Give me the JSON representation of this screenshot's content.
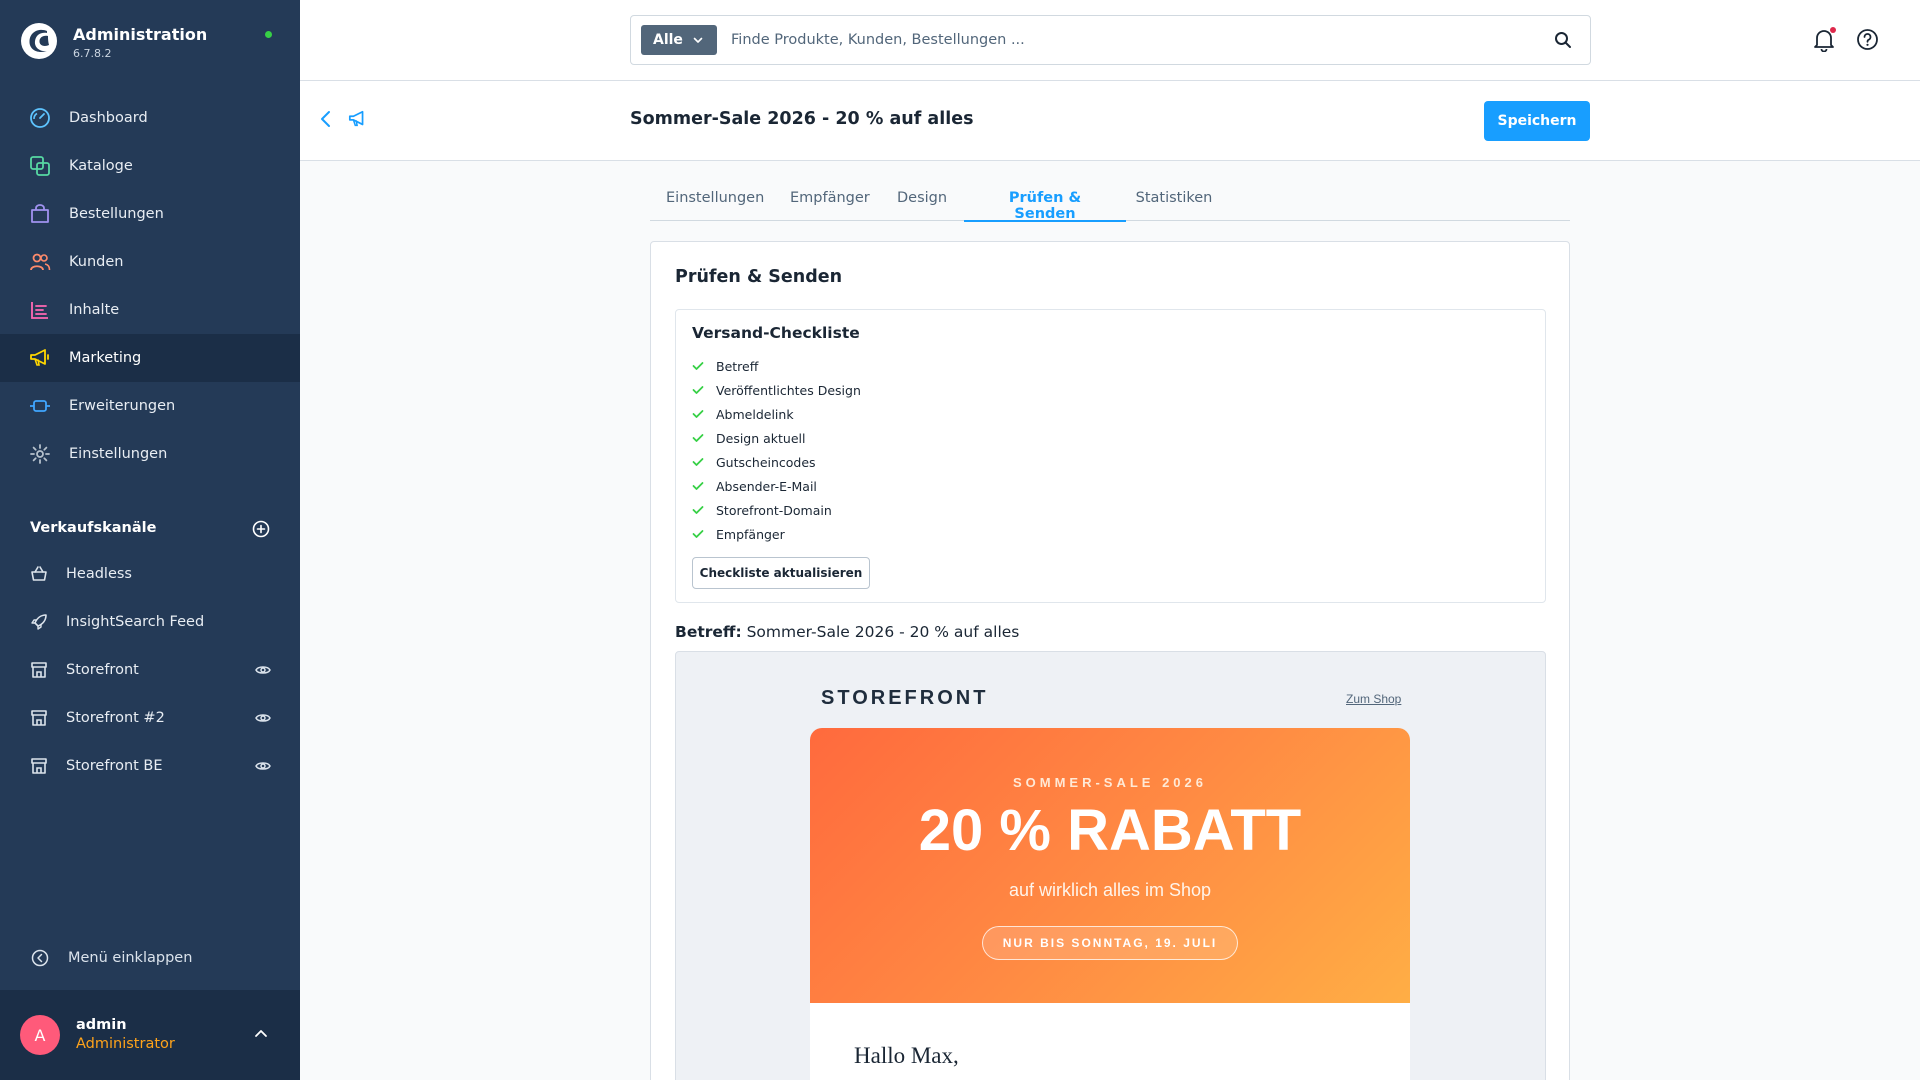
{
  "app": {
    "title": "Administration",
    "version": "6.7.8.2"
  },
  "sidebar": {
    "nav": [
      {
        "label": "Dashboard",
        "icon": "dashboard-icon"
      },
      {
        "label": "Kataloge",
        "icon": "catalog-icon"
      },
      {
        "label": "Bestellungen",
        "icon": "shopping-bag-icon"
      },
      {
        "label": "Kunden",
        "icon": "users-icon"
      },
      {
        "label": "Inhalte",
        "icon": "content-icon"
      },
      {
        "label": "Marketing",
        "icon": "megaphone-icon",
        "active": true
      },
      {
        "label": "Erweiterungen",
        "icon": "plug-icon"
      },
      {
        "label": "Einstellungen",
        "icon": "gear-icon"
      }
    ],
    "sales_channels_title": "Verkaufskanäle",
    "sales_channels": [
      {
        "label": "Headless",
        "icon": "basket-icon",
        "preview": false
      },
      {
        "label": "InsightSearch Feed",
        "icon": "rocket-icon",
        "preview": false
      },
      {
        "label": "Storefront",
        "icon": "storefront-icon",
        "preview": true
      },
      {
        "label": "Storefront #2",
        "icon": "storefront-icon",
        "preview": true
      },
      {
        "label": "Storefront BE",
        "icon": "storefront-icon",
        "preview": true
      }
    ],
    "collapse_label": "Menü einklappen",
    "user": {
      "initial": "A",
      "name": "admin",
      "role": "Administrator"
    }
  },
  "topbar": {
    "search_type": "Alle",
    "search_placeholder": "Finde Produkte, Kunden, Bestellungen ..."
  },
  "smartbar": {
    "title": "Sommer-Sale 2026 - 20 % auf alles",
    "save_label": "Speichern"
  },
  "tabs": [
    {
      "label": "Einstellungen",
      "active": false
    },
    {
      "label": "Empfänger",
      "active": false
    },
    {
      "label": "Design",
      "active": false
    },
    {
      "label": "Prüfen & Senden",
      "active": true
    },
    {
      "label": "Statistiken",
      "active": false
    }
  ],
  "card": {
    "title": "Prüfen & Senden",
    "checklist_title": "Versand-Checkliste",
    "checklist": [
      "Betreff",
      "Veröffentlichtes Design",
      "Abmeldelink",
      "Design aktuell",
      "Gutscheincodes",
      "Absender-E-Mail",
      "Storefront-Domain",
      "Empfänger"
    ],
    "refresh_label": "Checkliste aktualisieren",
    "subject_label": "Betreff:",
    "subject_value": "Sommer-Sale 2026 - 20 % auf alles"
  },
  "email": {
    "brand": "STOREFRONT",
    "shop_link": "Zum Shop",
    "kicker": "SOMMER-SALE 2026",
    "headline": "20 % RABATT",
    "subline": "auf wirklich alles im Shop",
    "badge": "NUR BIS SONNTAG, 19. JULI",
    "greeting": "Hallo Max,"
  },
  "colors": {
    "sidebar": "#243a57",
    "sidebar_active": "#1b2e47",
    "primary": "#189eff",
    "check": "#37d046",
    "hero_start": "#ff6a3d",
    "hero_end": "#ffae45"
  }
}
